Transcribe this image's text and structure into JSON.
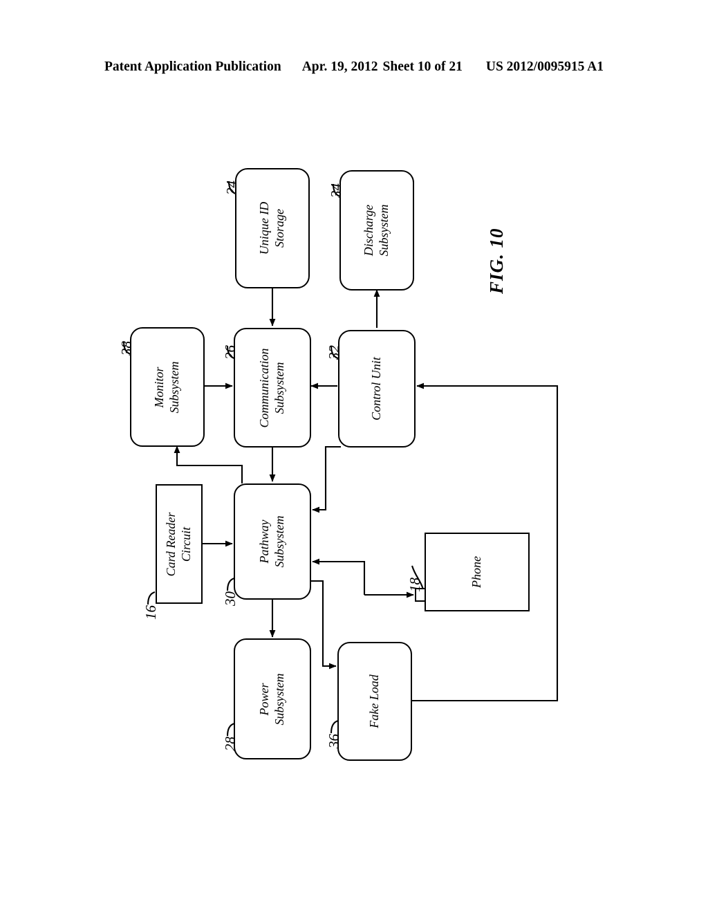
{
  "header": {
    "publication": "Patent Application Publication",
    "date": "Apr. 19, 2012",
    "sheet": "Sheet 10 of 21",
    "docnumber": "US 2012/0095915 A1"
  },
  "figure": {
    "label": "FIG. 10",
    "blocks": [
      {
        "id": "unique-id-storage",
        "ref": "24",
        "line1": "Unique ID",
        "line2": "Storage",
        "shape": "round"
      },
      {
        "id": "discharge-subsystem",
        "ref": "34",
        "line1": "Discharge",
        "line2": "Subsystem",
        "shape": "round"
      },
      {
        "id": "monitor-subsystem",
        "ref": "38",
        "line1": "Monitor",
        "line2": "Subsystem",
        "shape": "round"
      },
      {
        "id": "communication-subsystem",
        "ref": "26",
        "line1": "Communication",
        "line2": "Subsystem",
        "shape": "round"
      },
      {
        "id": "control-unit",
        "ref": "32",
        "line1": "Control Unit",
        "line2": "",
        "shape": "round"
      },
      {
        "id": "card-reader-circuit",
        "ref": "16",
        "line1": "Card Reader",
        "line2": "Circuit",
        "shape": "sharp"
      },
      {
        "id": "pathway-subsystem",
        "ref": "30",
        "line1": "Pathway",
        "line2": "Subsystem",
        "shape": "round"
      },
      {
        "id": "power-subsystem",
        "ref": "28",
        "line1": "Power",
        "line2": "Subsystem",
        "shape": "round"
      },
      {
        "id": "fake-load",
        "ref": "36",
        "line1": "Fake Load",
        "line2": "",
        "shape": "round"
      },
      {
        "id": "phone",
        "ref": "18",
        "line1": "Phone",
        "line2": "",
        "shape": "sharp"
      }
    ]
  },
  "colors": {
    "ink": "#000000",
    "page": "#ffffff"
  }
}
